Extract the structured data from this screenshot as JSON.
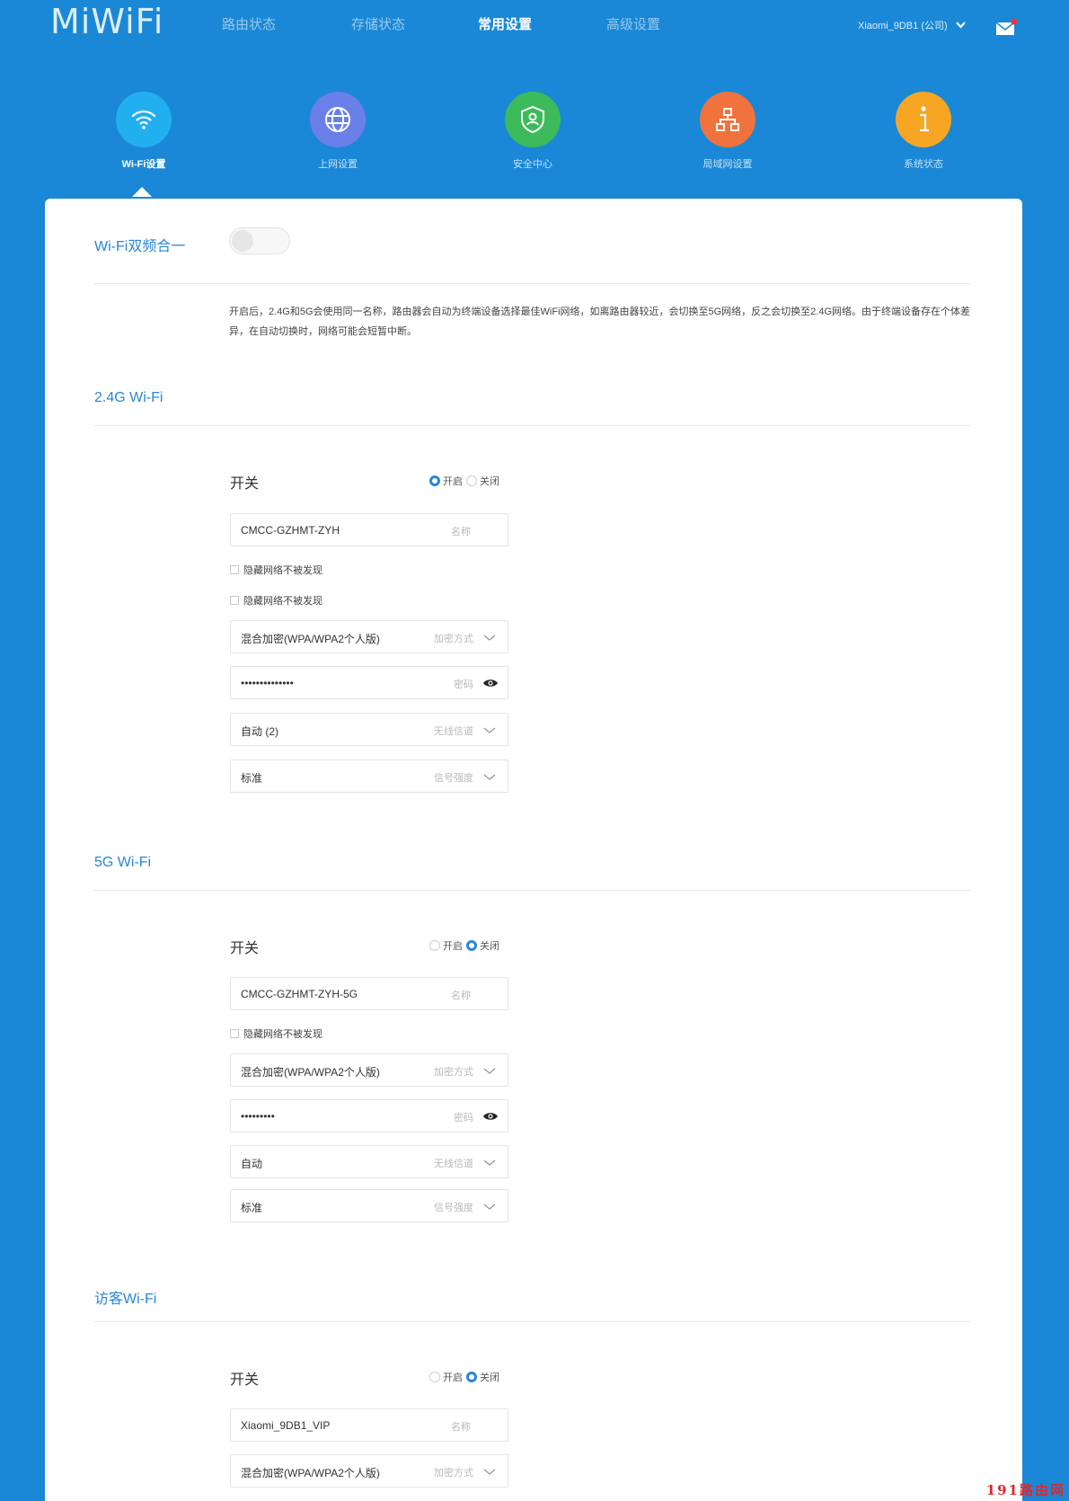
{
  "header": {
    "logo": "MiWiFi",
    "nav": [
      {
        "label": "路由状态",
        "active": false
      },
      {
        "label": "存储状态",
        "active": false
      },
      {
        "label": "常用设置",
        "active": true
      },
      {
        "label": "高级设置",
        "active": false
      }
    ],
    "account": "Xiaomi_9DB1 (公司)"
  },
  "tiles": [
    {
      "label": "Wi-Fi设置",
      "icon": "wifi-icon",
      "color": "#22aff0",
      "active": true
    },
    {
      "label": "上网设置",
      "icon": "globe-icon",
      "color": "#6b7fe8",
      "active": false
    },
    {
      "label": "安全中心",
      "icon": "shield-icon",
      "color": "#3dbb5a",
      "active": false
    },
    {
      "label": "局域网设置",
      "icon": "lan-icon",
      "color": "#f0733d",
      "active": false
    },
    {
      "label": "系统状态",
      "icon": "info-icon",
      "color": "#f7a623",
      "active": false
    }
  ],
  "dual_band": {
    "title": "Wi-Fi双频合一",
    "enabled": false,
    "description": "开启后，2.4G和5G会使用同一名称，路由器会自动为终端设备选择最佳WiFi网络，如离路由器较近，会切换至5G网络，反之会切换至2.4G网络。由于终端设备存在个体差异，在自动切换时，网络可能会短暂中断。"
  },
  "wifi24": {
    "title": "2.4G Wi-Fi",
    "switch_label": "开关",
    "on_label": "开启",
    "off_label": "关闭",
    "selected": "on",
    "ssid": "CMCC-GZHMT-ZYH",
    "ssid_hint": "名称",
    "hide_label_1": "隐藏网络不被发现",
    "hide_label_2": "隐藏网络不被发现",
    "encryption": "混合加密(WPA/WPA2个人版)",
    "encryption_hint": "加密方式",
    "password": "••••••••••••••",
    "password_hint": "密码",
    "channel": "自动 (2)",
    "channel_hint": "无线信道",
    "strength": "标准",
    "strength_hint": "信号强度"
  },
  "wifi5": {
    "title": "5G Wi-Fi",
    "switch_label": "开关",
    "on_label": "开启",
    "off_label": "关闭",
    "selected": "off",
    "ssid": "CMCC-GZHMT-ZYH-5G",
    "ssid_hint": "名称",
    "hide_label": "隐藏网络不被发现",
    "encryption": "混合加密(WPA/WPA2个人版)",
    "encryption_hint": "加密方式",
    "password": "•••••••••",
    "password_hint": "密码",
    "channel": "自动",
    "channel_hint": "无线信道",
    "strength": "标准",
    "strength_hint": "信号强度"
  },
  "guest": {
    "title": "访客Wi-Fi",
    "switch_label": "开关",
    "on_label": "开启",
    "off_label": "关闭",
    "selected": "off",
    "ssid": "Xiaomi_9DB1_VIP",
    "ssid_hint": "名称",
    "encryption": "混合加密(WPA/WPA2个人版)",
    "encryption_hint": "加密方式"
  },
  "watermark": "191路由网",
  "colors": {
    "background": "#1a88d6",
    "accent": "#2a86d6"
  }
}
